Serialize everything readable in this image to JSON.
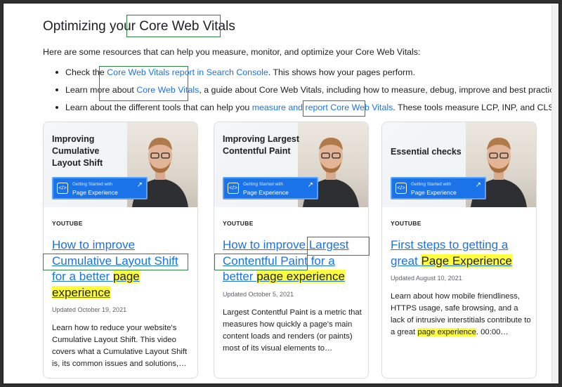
{
  "page": {
    "title": "Optimizing your Core Web Vitals",
    "intro": "Here are some resources that can help you measure, monitor, and optimize your Core Web Vitals:"
  },
  "bullets": [
    {
      "before": "Check the ",
      "link": "Core Web Vitals report in Search Console",
      "after": ". This shows how your pages perform."
    },
    {
      "before": "Learn more about ",
      "link": "Core Web Vitals",
      "after": ", a guide about Core Web Vitals, including how to measure, debug, improve and best practices."
    },
    {
      "before": "Learn about the different tools that can help you ",
      "link": "measure and report Core Web Vitals",
      "after": ". These tools measure LCP, INP, and CLS."
    }
  ],
  "banner": {
    "small": "Getting Started with",
    "big": "Page Experience"
  },
  "cards": [
    {
      "thumb_title": "Improving Cumulative Layout Shift",
      "source": "YOUTUBE",
      "title_plain": "How to improve Cumulative Layout Shift for a better ",
      "title_hl": "page experience",
      "updated": "Updated October 19, 2021",
      "desc": "Learn how to reduce your website's Cumulative Layout Shift. This video covers what a Cumulative Layout Shift is, its common issues and solutions,…"
    },
    {
      "thumb_title": "Improving Largest Contentful Paint",
      "source": "YOUTUBE",
      "title_plain": "How to improve Largest Contentful Paint for a better ",
      "title_hl": "page experience",
      "updated": "Updated October 5, 2021",
      "desc": "Largest Contentful Paint is a metric that measures how quickly a page's main content loads and renders (or paints) most of its visual elements to…"
    },
    {
      "thumb_title": "Essential checks",
      "source": "YOUTUBE",
      "title_plain": "First steps to getting a great ",
      "title_hl": "Page Experience",
      "updated": "Updated August 10, 2021",
      "desc_before": "Learn about how mobile friendliness, HTTPS usage, safe browsing, and a lack of intrusive interstitials contribute to a great ",
      "desc_hl": "page experience",
      "desc_after": ". 00:00…"
    }
  ],
  "colors": {
    "link": "#1a73e8",
    "highlight": "#ffff3d",
    "annotation_box": "#2e8540"
  }
}
